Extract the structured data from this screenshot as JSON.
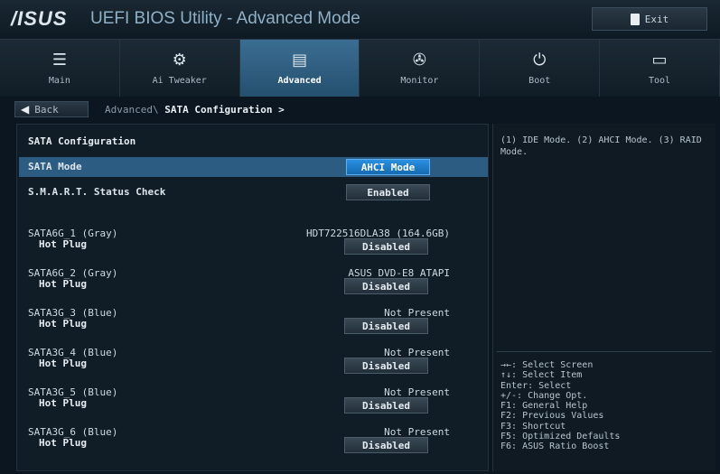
{
  "header": {
    "logo": "/ISUS",
    "title": "UEFI BIOS Utility - Advanced Mode",
    "exit_label": "Exit"
  },
  "tabs": [
    {
      "label": "Main",
      "icon": "list-icon"
    },
    {
      "label": "Ai Tweaker",
      "icon": "tweaker-icon"
    },
    {
      "label": "Advanced",
      "icon": "advanced-icon",
      "active": true
    },
    {
      "label": "Monitor",
      "icon": "monitor-icon"
    },
    {
      "label": "Boot",
      "icon": "power-icon"
    },
    {
      "label": "Tool",
      "icon": "tool-icon"
    }
  ],
  "breadcrumb": {
    "back_label": "Back",
    "path_prefix": "Advanced\\",
    "path_current": "SATA Configuration >"
  },
  "main": {
    "section_title": "SATA Configuration",
    "sata_mode": {
      "label": "SATA Mode",
      "value": "AHCI Mode"
    },
    "smart": {
      "label": "S.M.A.R.T. Status Check",
      "value": "Enabled"
    },
    "ports": [
      {
        "name": "SATA6G_1 (Gray)",
        "device": "HDT722516DLA38  (164.6GB)",
        "plug_label": "Hot Plug",
        "plug_value": "Disabled"
      },
      {
        "name": "SATA6G_2 (Gray)",
        "device": "ASUS    DVD-E8 ATAPI",
        "plug_label": "Hot Plug",
        "plug_value": "Disabled"
      },
      {
        "name": "SATA3G_3 (Blue)",
        "device": "Not Present",
        "plug_label": "Hot Plug",
        "plug_value": "Disabled"
      },
      {
        "name": "SATA3G_4 (Blue)",
        "device": "Not Present",
        "plug_label": "Hot Plug",
        "plug_value": "Disabled"
      },
      {
        "name": "SATA3G_5 (Blue)",
        "device": "Not Present",
        "plug_label": "Hot Plug",
        "plug_value": "Disabled"
      },
      {
        "name": "SATA3G_6 (Blue)",
        "device": "Not Present",
        "plug_label": "Hot Plug",
        "plug_value": "Disabled"
      }
    ]
  },
  "help": {
    "description": "(1) IDE Mode. (2) AHCI Mode. (3) RAID Mode.",
    "keys": [
      "→←: Select Screen",
      "↑↓: Select Item",
      "Enter: Select",
      "+/-: Change Opt.",
      "F1: General Help",
      "F2: Previous Values",
      "F3: Shortcut",
      "F5: Optimized Defaults",
      "F6: ASUS Ratio Boost"
    ]
  },
  "colors": {
    "accent": "#2b8fe0",
    "selected_row": "#2d5c82",
    "active_tab": "#3b6d92"
  }
}
